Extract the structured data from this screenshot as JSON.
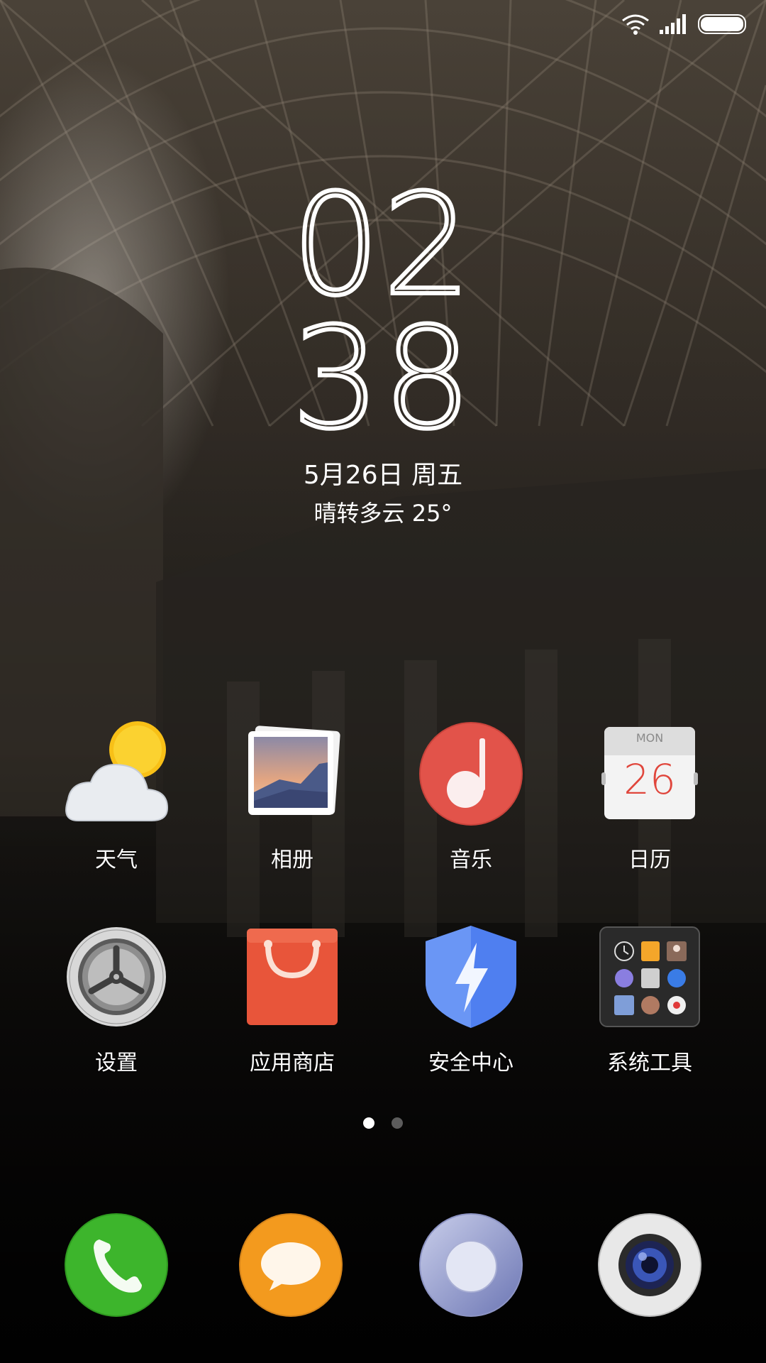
{
  "status_bar": {
    "wifi_icon": "wifi-icon",
    "signal_icon": "signal-bars-icon",
    "battery_icon": "battery-icon",
    "battery_level": 1.0
  },
  "lock_clock": {
    "hour": "02",
    "minute": "38",
    "date": "5月26日 周五",
    "weather": "晴转多云  25°"
  },
  "apps": [
    {
      "label": "天气",
      "icon": "weather-icon"
    },
    {
      "label": "相册",
      "icon": "gallery-icon"
    },
    {
      "label": "音乐",
      "icon": "music-icon"
    },
    {
      "label": "日历",
      "icon": "calendar-icon",
      "calendar_day": "MON",
      "calendar_date": "26"
    },
    {
      "label": "设置",
      "icon": "settings-gear-icon"
    },
    {
      "label": "应用商店",
      "icon": "app-store-bag-icon"
    },
    {
      "label": "安全中心",
      "icon": "security-shield-icon"
    },
    {
      "label": "系统工具",
      "icon": "system-tools-folder-icon"
    }
  ],
  "pager": {
    "pages": 2,
    "current": 1
  },
  "dock": [
    {
      "icon": "phone-icon"
    },
    {
      "icon": "messages-icon"
    },
    {
      "icon": "browser-icon"
    },
    {
      "icon": "camera-icon"
    }
  ],
  "colors": {
    "phone_green": "#3db52c",
    "messages_orange": "#f39a1e",
    "music_red": "#e2534a",
    "store_orange": "#e8553a",
    "shield_blue": "#4f7ff0"
  }
}
